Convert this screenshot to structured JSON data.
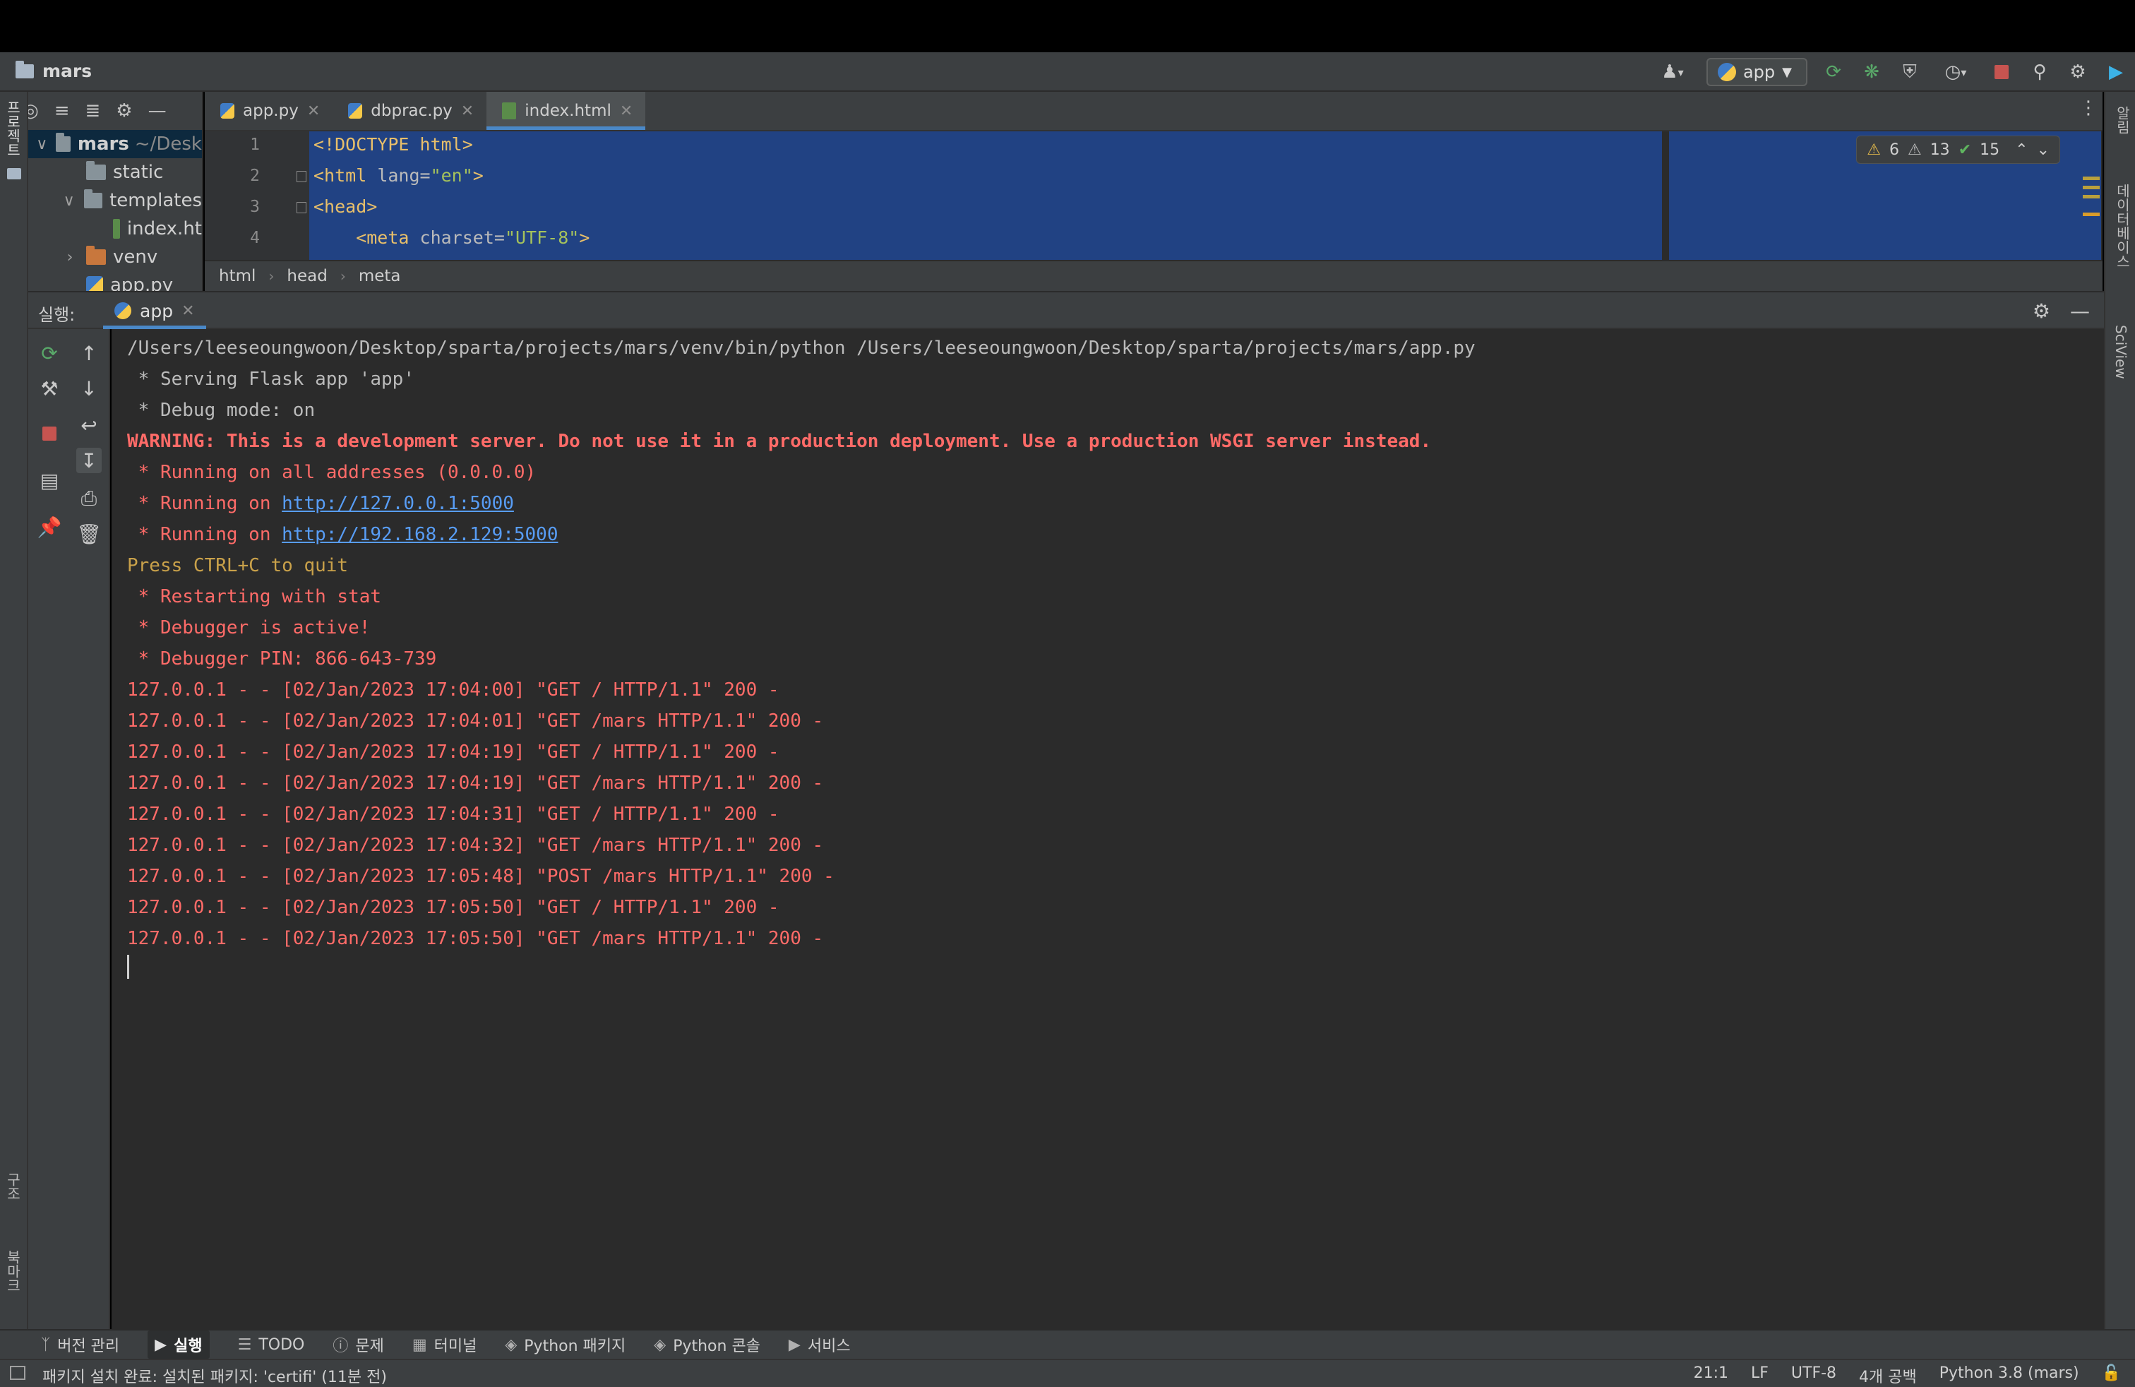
{
  "titlebar": {
    "project_name": "mars",
    "run_config": "app"
  },
  "left_stripe": {
    "project_label": "프로젝트",
    "structure_label": "구조",
    "bookmarks_label": "북마크"
  },
  "right_stripe": {
    "notifications_label": "알림",
    "database_label": "데이터베이스",
    "sciview_label": "SciView"
  },
  "project_tree": {
    "root_name": "mars",
    "root_path": "~/Desk",
    "items": [
      {
        "name": "static",
        "type": "folder"
      },
      {
        "name": "templates",
        "type": "folder"
      },
      {
        "name": "index.ht",
        "type": "html"
      },
      {
        "name": "venv",
        "type": "folder"
      },
      {
        "name": "app.py",
        "type": "python"
      }
    ]
  },
  "editor_tabs": [
    {
      "label": "app.py",
      "active": false
    },
    {
      "label": "dbprac.py",
      "active": false
    },
    {
      "label": "index.html",
      "active": true
    }
  ],
  "editor": {
    "line_numbers": [
      "1",
      "2",
      "3",
      "4"
    ],
    "lines": {
      "l1": "<!DOCTYPE html>",
      "l2_tag": "<html ",
      "l2_attr": "lang=",
      "l2_str": "\"en\"",
      "l2_end": ">",
      "l3": "<head>",
      "l4_tag": "    <meta ",
      "l4_attr": "charset=",
      "l4_str": "\"UTF-8\"",
      "l4_end": ">"
    },
    "inspections": {
      "warnings": "6",
      "weak_warnings": "13",
      "ok": "15"
    }
  },
  "breadcrumb": [
    "html",
    "head",
    "meta"
  ],
  "run_panel": {
    "label": "실행:",
    "tab_label": "app"
  },
  "console": {
    "cmd": "/Users/leeseoungwoon/Desktop/sparta/projects/mars/venv/bin/python /Users/leeseoungwoon/Desktop/sparta/projects/mars/app.py",
    "serving": " * Serving Flask app 'app'",
    "debug_mode": " * Debug mode: on",
    "warning": "WARNING: This is a development server. Do not use it in a production deployment. Use a production WSGI server instead.",
    "all_addr": " * Running on all addresses (0.0.0.0)",
    "running_prefix": " * Running on ",
    "url1": "http://127.0.0.1:5000",
    "url2": "http://192.168.2.129:5000",
    "quit": "Press CTRL+C to quit",
    "restarting": " * Restarting with stat",
    "debugger_active": " * Debugger is active!",
    "debugger_pin": " * Debugger PIN: 866-643-739",
    "log": [
      "127.0.0.1 - - [02/Jan/2023 17:04:00] \"GET / HTTP/1.1\" 200 -",
      "127.0.0.1 - - [02/Jan/2023 17:04:01] \"GET /mars HTTP/1.1\" 200 -",
      "127.0.0.1 - - [02/Jan/2023 17:04:19] \"GET / HTTP/1.1\" 200 -",
      "127.0.0.1 - - [02/Jan/2023 17:04:19] \"GET /mars HTTP/1.1\" 200 -",
      "127.0.0.1 - - [02/Jan/2023 17:04:31] \"GET / HTTP/1.1\" 200 -",
      "127.0.0.1 - - [02/Jan/2023 17:04:32] \"GET /mars HTTP/1.1\" 200 -",
      "127.0.0.1 - - [02/Jan/2023 17:05:48] \"POST /mars HTTP/1.1\" 200 -",
      "127.0.0.1 - - [02/Jan/2023 17:05:50] \"GET / HTTP/1.1\" 200 -",
      "127.0.0.1 - - [02/Jan/2023 17:05:50] \"GET /mars HTTP/1.1\" 200 -"
    ]
  },
  "bottom_tools": [
    {
      "label": "버전 관리",
      "icon": "branch-icon"
    },
    {
      "label": "실행",
      "icon": "run-icon",
      "active": true
    },
    {
      "label": "TODO",
      "icon": "list-icon"
    },
    {
      "label": "문제",
      "icon": "problems-icon"
    },
    {
      "label": "터미널",
      "icon": "terminal-icon"
    },
    {
      "label": "Python 패키지",
      "icon": "packages-icon"
    },
    {
      "label": "Python 콘솔",
      "icon": "python-console-icon"
    },
    {
      "label": "서비스",
      "icon": "services-icon"
    }
  ],
  "status_bar": {
    "message": "패키지 설치 완료: 설치된 패키지: 'certifi' (11분 전)",
    "position": "21:1",
    "line_sep": "LF",
    "encoding": "UTF-8",
    "indent": "4개 공백",
    "interpreter": "Python 3.8 (mars)"
  },
  "colors": {
    "accent": "#4a88c7",
    "selection": "#214283",
    "console_error": "#ff6b68",
    "link": "#589df6"
  }
}
